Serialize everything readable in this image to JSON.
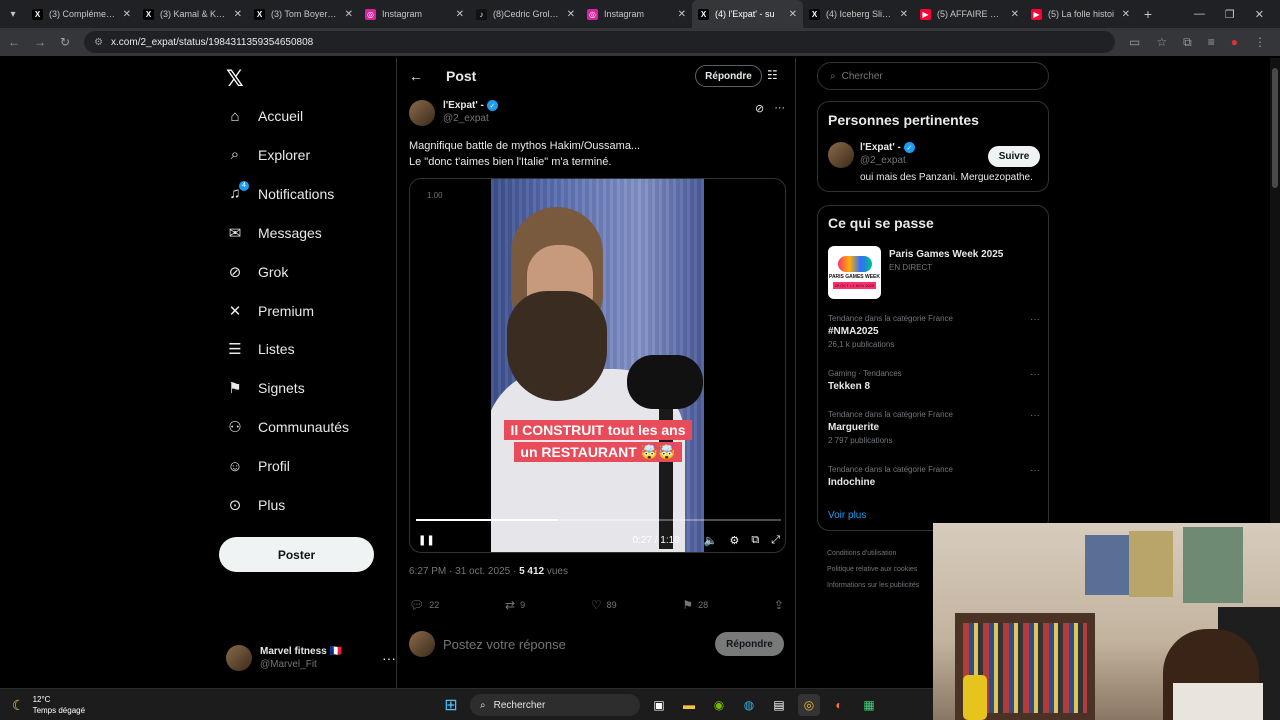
{
  "browser": {
    "tabs": [
      {
        "title": "(3) Complément d",
        "icon": "x-logo-icon",
        "active": false
      },
      {
        "title": "(3) Kamal & Kyta",
        "icon": "x-logo-icon",
        "active": false
      },
      {
        "title": "(3) Tom Boyer sur",
        "icon": "x-logo-icon",
        "active": false
      },
      {
        "title": "Instagram",
        "icon": "instagram-icon",
        "active": false
      },
      {
        "title": "(8)Cedric Grolet (",
        "icon": "tiktok-icon",
        "active": false
      },
      {
        "title": "Instagram",
        "icon": "instagram-icon",
        "active": false
      },
      {
        "title": "(4) l'Expat' - su",
        "icon": "x-logo-icon",
        "active": true
      },
      {
        "title": "(4) Iceberg Slim su",
        "icon": "x-logo-icon",
        "active": false
      },
      {
        "title": "(5) AFFAIRE SARK",
        "icon": "youtube-icon",
        "active": false
      },
      {
        "title": "(5) La folle histoi",
        "icon": "youtube-icon",
        "active": false
      }
    ],
    "url": "x.com/2_expat/status/1984311359354650808"
  },
  "nav": {
    "items": [
      {
        "label": "Accueil",
        "icon": "home-icon",
        "glyph": "⌂"
      },
      {
        "label": "Explorer",
        "icon": "search-icon",
        "glyph": "⌕"
      },
      {
        "label": "Notifications",
        "icon": "bell-icon",
        "glyph": "♫",
        "badge": "4"
      },
      {
        "label": "Messages",
        "icon": "envelope-icon",
        "glyph": "✉"
      },
      {
        "label": "Grok",
        "icon": "grok-icon",
        "glyph": "⊘"
      },
      {
        "label": "Premium",
        "icon": "x-logo-icon",
        "glyph": "✕"
      },
      {
        "label": "Listes",
        "icon": "list-icon",
        "glyph": "☰"
      },
      {
        "label": "Signets",
        "icon": "bookmark-icon",
        "glyph": "⚑"
      },
      {
        "label": "Communautés",
        "icon": "people-icon",
        "glyph": "⚇"
      },
      {
        "label": "Profil",
        "icon": "person-icon",
        "glyph": "☺"
      },
      {
        "label": "Plus",
        "icon": "more-circle-icon",
        "glyph": "⊙"
      }
    ],
    "post_button": "Poster",
    "account": {
      "name": "Marvel fitness 🇫🇷",
      "handle": "@Marvel_Fit"
    }
  },
  "post": {
    "header_title": "Post",
    "reply_pill": "Répondre",
    "author": {
      "name": "l'Expat' -",
      "handle": "@2_expat"
    },
    "text_line1": "Magnifique battle de mythos Hakim/Oussama...",
    "text_line2": "Le \"donc t'aimes bien l'Italie\" m'a terminé.",
    "video": {
      "speed": "1.00",
      "caption_line1": "Il CONSTRUIT tout les ans",
      "caption_line2": "un RESTAURANT 🤯🤯",
      "time": "0:27 / 1:10",
      "progress": 0.39
    },
    "timestamp": "6:27 PM · 31 oct. 2025 · ",
    "views_count": "5 412",
    "views_label": " vues",
    "actions": {
      "replies": "22",
      "reposts": "9",
      "likes": "89",
      "bookmarks": "28"
    },
    "reply_placeholder": "Postez votre réponse",
    "reply_button": "Répondre"
  },
  "sidebar": {
    "search_placeholder": "Chercher",
    "relevant": {
      "title": "Personnes pertinentes",
      "name": "l'Expat' -",
      "handle": "@2_expat",
      "bio": "oui mais des Panzani. Merguezopathe.",
      "follow": "Suivre"
    },
    "trends": {
      "title": "Ce qui se passe",
      "event": {
        "name": "Paris Games Week 2025",
        "status": "EN DIRECT",
        "image_title": "PARIS GAMES WEEK",
        "image_dates": "29 OCT • 2 NOV 2025"
      },
      "items": [
        {
          "category": "Tendance dans la catégorie France",
          "name": "#NMA2025",
          "count": "26,1 k publications"
        },
        {
          "category": "Gaming · Tendances",
          "name": "Tekken 8",
          "count": ""
        },
        {
          "category": "Tendance dans la catégorie France",
          "name": "Marguerite",
          "count": "2 797 publications"
        },
        {
          "category": "Tendance dans la catégorie France",
          "name": "Indochine",
          "count": ""
        }
      ],
      "see_more": "Voir plus"
    },
    "footer": [
      "Conditions d'utilisation",
      "Politique relative aux cookies",
      "Informations sur les publicités"
    ]
  },
  "taskbar": {
    "temperature": "12°C",
    "weather": "Temps dégagé",
    "search": "Rechercher"
  },
  "colors": {
    "accent": "#1d9bf0",
    "background": "#000000",
    "border": "#2f3336"
  }
}
